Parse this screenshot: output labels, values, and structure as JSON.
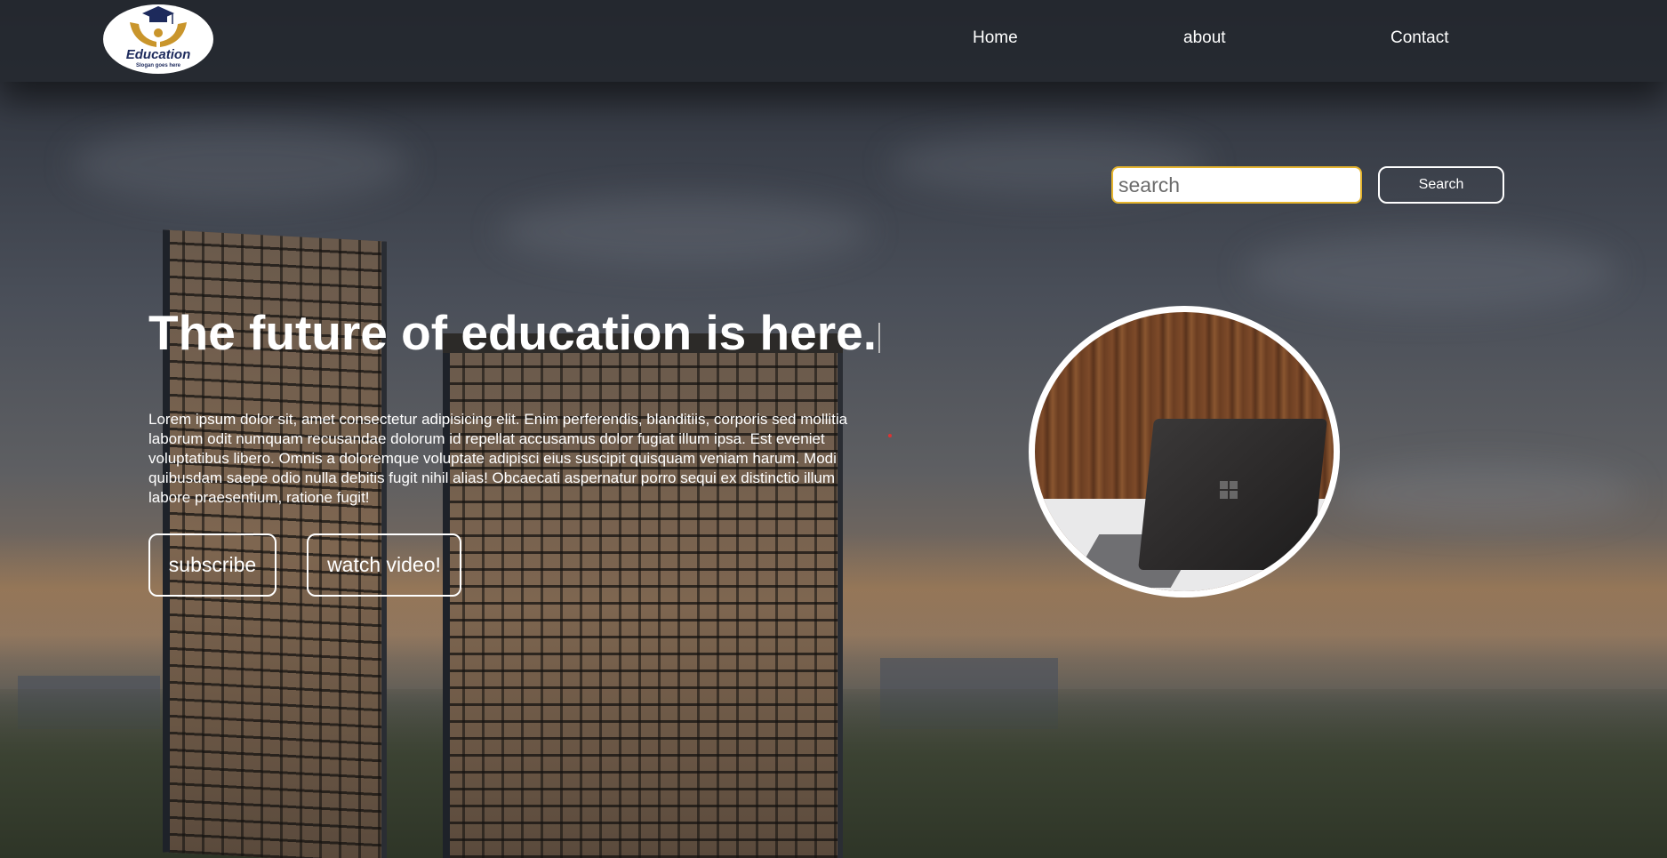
{
  "header": {
    "logo": {
      "brand": "Education",
      "slogan": "Slogan goes here",
      "icon": "graduation-cap-hands-icon"
    },
    "nav": [
      {
        "label": "Home"
      },
      {
        "label": "about"
      },
      {
        "label": "Contact"
      }
    ]
  },
  "search": {
    "placeholder": "search",
    "value": "",
    "button_label": "Search"
  },
  "hero": {
    "title": "The future of education is here.",
    "body": "Lorem ipsum dolor sit, amet consectetur adipisicing elit. Enim perferendis, blanditiis, corporis sed mollitia laborum odit numquam recusandae dolorum id repellat accusamus dolor fugiat illum ipsa. Est eveniet voluptatibus libero. Omnis a doloremque voluptate adipisci eius suscipit quisquam veniam harum. Modi quibusdam saepe odio nulla debitis fugit nihil alias! Obcaecati aspernatur porro sequi ex distinctio illum labore praesentium, ratione fugit!",
    "subscribe_label": "subscribe",
    "video_label": "watch video!",
    "image": "laptop-on-table-image"
  },
  "colors": {
    "search_border": "#e6b52e",
    "logo_blue": "#1d2a5c",
    "logo_gold": "#c9952b"
  }
}
